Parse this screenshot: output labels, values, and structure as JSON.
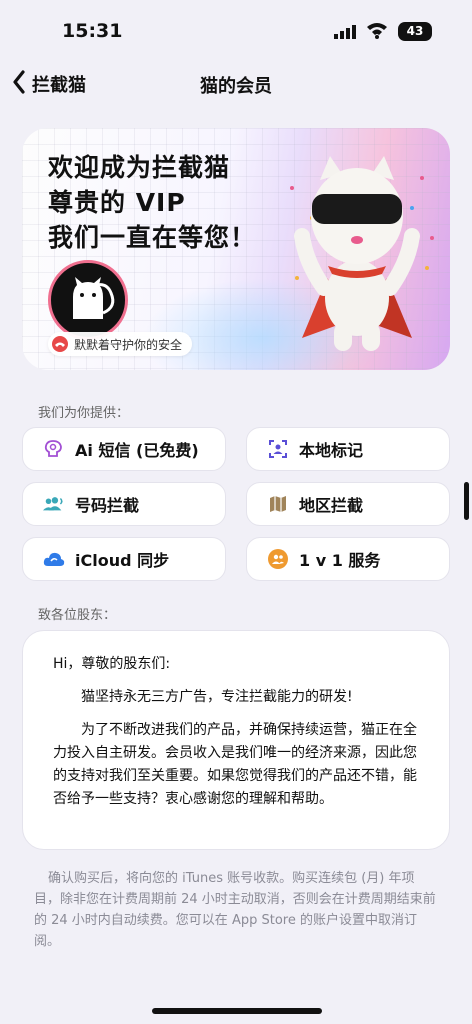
{
  "status_bar": {
    "time": "15:31",
    "battery": "43"
  },
  "nav": {
    "back_label": "拦截猫",
    "title": "猫的会员"
  },
  "hero": {
    "line1": "欢迎成为拦截猫",
    "line2": "尊贵的 VIP",
    "line3": "我们一直在等您！",
    "pill_text": "默默着守护你的安全"
  },
  "features_section": {
    "label": "我们为你提供："
  },
  "features": [
    {
      "label": "Ai 短信 (已免费)",
      "icon": "ai-brain-icon",
      "color": "#a24fd4"
    },
    {
      "label": "本地标记",
      "icon": "scan-person-icon",
      "color": "#5a4fd6"
    },
    {
      "label": "号码拦截",
      "icon": "people-block-icon",
      "color": "#3aa8b8"
    },
    {
      "label": "地区拦截",
      "icon": "map-icon",
      "color": "#a0845a"
    },
    {
      "label": "iCloud 同步",
      "icon": "cloud-icon",
      "color": "#2f7be8"
    },
    {
      "label": "1 v 1 服务",
      "icon": "support-icon",
      "color": "#ef9a30"
    }
  ],
  "letter_section": {
    "label": "致各位股东："
  },
  "letter": {
    "greeting": "Hi，尊敬的股东们:",
    "para1": "猫坚持永无三方广告，专注拦截能力的研发!",
    "para2": "为了不断改进我们的产品，并确保持续运营，猫正在全力投入自主研发。会员收入是我们唯一的经济来源，因此您的支持对我们至关重要。如果您觉得我们的产品还不错，能否给予一些支持？衷心感谢您的理解和帮助。"
  },
  "footnote": "确认购买后，将向您的 iTunes 账号收款。购买连续包 (月) 年项目，除非您在计费周期前 24 小时主动取消，否则会在计费周期结束前的 24 小时内自动续费。您可以在 App Store 的账户设置中取消订阅。"
}
